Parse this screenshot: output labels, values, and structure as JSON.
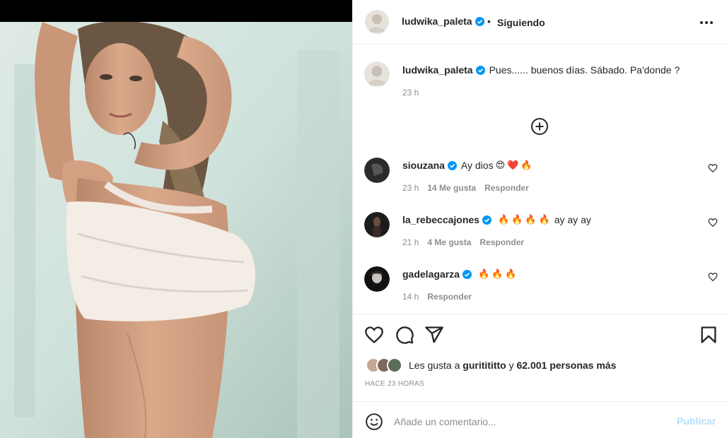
{
  "post": {
    "author": "ludwika_paleta",
    "follow_status": "Siguiendo",
    "separator": "•",
    "caption": "Pues...... buenos días. Sábado. Pa'donde ?",
    "caption_time": "23 h"
  },
  "comments": [
    {
      "user": "siouzana",
      "text": "Ay dios",
      "emojis": [
        "😍",
        "❤️",
        "🔥"
      ],
      "time": "23 h",
      "likes": "14 Me gusta",
      "reply": "Responder"
    },
    {
      "user": "la_rebeccajones",
      "text_before": "",
      "emojis": [
        "🔥",
        "🔥",
        "🔥",
        "🔥"
      ],
      "text": "ay ay ay",
      "time": "21 h",
      "likes": "4 Me gusta",
      "reply": "Responder"
    },
    {
      "user": "gadelagarza",
      "emojis": [
        "🔥",
        "🔥",
        "🔥"
      ],
      "time": "14 h",
      "reply": "Responder"
    }
  ],
  "likes_summary": {
    "prefix": "Les gusta a",
    "first_user": "guritititto",
    "connector": "y",
    "others": "62.001 personas más"
  },
  "post_age": "HACE 23 HORAS",
  "comment_box": {
    "placeholder": "Añade un comentario...",
    "publish_label": "Publicar"
  },
  "icons": {
    "more": "more-options-icon",
    "add_comments": "plus-circle-icon",
    "like": "heart-icon",
    "comment": "comment-bubble-icon",
    "share": "paper-plane-icon",
    "save": "bookmark-icon",
    "emoji": "smiley-icon",
    "verified": "verified-badge-icon"
  },
  "colors": {
    "verified_blue": "#0095f6",
    "publish_disabled": "#b2dffc",
    "muted_text": "#8e8e8e"
  }
}
